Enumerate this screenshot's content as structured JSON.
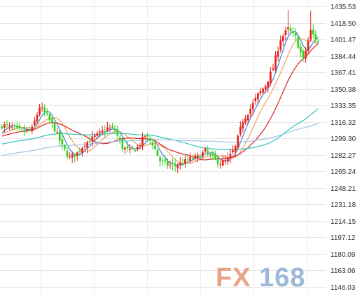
{
  "chart_data": {
    "type": "candlestick",
    "title": "",
    "xlabel": "",
    "ylabel": "",
    "ylim": [
      1146.03,
      1435.53
    ],
    "y_ticks": [
      {
        "value": 1435.53,
        "label": "1435.53"
      },
      {
        "value": 1418.5,
        "label": "1418.50"
      },
      {
        "value": 1401.47,
        "label": "1401.47"
      },
      {
        "value": 1384.44,
        "label": "1384.44"
      },
      {
        "value": 1367.41,
        "label": "1367.41"
      },
      {
        "value": 1350.38,
        "label": "1350.38"
      },
      {
        "value": 1333.35,
        "label": "1333.35"
      },
      {
        "value": 1316.32,
        "label": "1316.32"
      },
      {
        "value": 1299.3,
        "label": "1299.30"
      },
      {
        "value": 1282.27,
        "label": "1282.27"
      },
      {
        "value": 1265.24,
        "label": "1265.24"
      },
      {
        "value": 1248.21,
        "label": "1248.21"
      },
      {
        "value": 1231.18,
        "label": "1231.18"
      },
      {
        "value": 1214.15,
        "label": "1214.15"
      },
      {
        "value": 1197.12,
        "label": "1197.12"
      },
      {
        "value": 1180.09,
        "label": "1180.09"
      },
      {
        "value": 1163.06,
        "label": "1163.06"
      },
      {
        "value": 1146.03,
        "label": "1146.03"
      }
    ],
    "grid": true,
    "colors": {
      "up": "#e8231e",
      "down": "#33d11d"
    },
    "close_anchors": [
      [
        0,
        1313
      ],
      [
        3,
        1311
      ],
      [
        6,
        1308
      ],
      [
        9,
        1306
      ],
      [
        12,
        1309
      ],
      [
        15,
        1332
      ],
      [
        18,
        1322
      ],
      [
        21,
        1309
      ],
      [
        24,
        1291
      ],
      [
        27,
        1279
      ],
      [
        30,
        1284
      ],
      [
        33,
        1294
      ],
      [
        36,
        1299
      ],
      [
        39,
        1304
      ],
      [
        42,
        1310
      ],
      [
        45,
        1308
      ],
      [
        48,
        1290
      ],
      [
        51,
        1286
      ],
      [
        54,
        1290
      ],
      [
        57,
        1302
      ],
      [
        60,
        1294
      ],
      [
        63,
        1276
      ],
      [
        66,
        1272
      ],
      [
        69,
        1271
      ],
      [
        72,
        1274
      ],
      [
        75,
        1278
      ],
      [
        78,
        1280
      ],
      [
        81,
        1286
      ],
      [
        84,
        1279
      ],
      [
        87,
        1274
      ],
      [
        90,
        1277
      ],
      [
        93,
        1290
      ],
      [
        96,
        1318
      ],
      [
        99,
        1330
      ],
      [
        102,
        1344
      ],
      [
        105,
        1354
      ],
      [
        108,
        1372
      ],
      [
        111,
        1402
      ],
      [
        114,
        1412
      ],
      [
        117,
        1403
      ],
      [
        120,
        1380
      ],
      [
        123,
        1410
      ],
      [
        126,
        1398
      ]
    ],
    "series": [
      {
        "type": "line",
        "color": "#3a7fd6",
        "window": 5
      },
      {
        "type": "line",
        "color": "#f0a060",
        "window": 10
      },
      {
        "type": "line",
        "color": "#e02020",
        "window": 20
      },
      {
        "type": "line",
        "color": "#2ec4b6",
        "window": 60
      },
      {
        "type": "line",
        "color": "#9cc3e6",
        "window": 120
      }
    ]
  },
  "watermark": {
    "part1": "FX",
    "part2": "168",
    "color1": "#e8a48a",
    "color2": "#9eb8d8"
  }
}
